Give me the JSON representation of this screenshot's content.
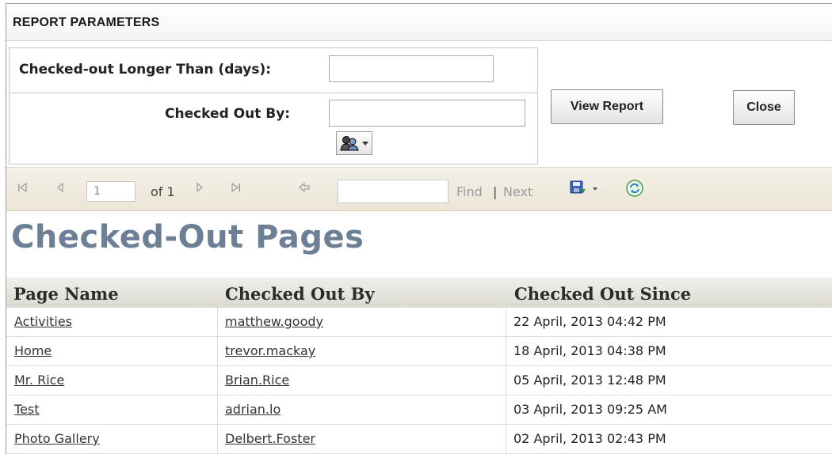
{
  "params": {
    "header": "REPORT PARAMETERS",
    "checked_out_longer_label": "Checked-out Longer Than (days):",
    "checked_out_longer_value": "",
    "checked_out_by_label": "Checked Out By:",
    "checked_out_by_value": "",
    "people_picker_icon": "people-picker-icon",
    "view_report_label": "View Report",
    "close_label": "Close"
  },
  "toolbar": {
    "page_value": "1",
    "of_text": "of 1",
    "find_value": "",
    "find_label": "Find",
    "separator": "|",
    "next_label": "Next",
    "icons": [
      "first-page-icon",
      "previous-page-icon",
      "next-page-icon",
      "last-page-icon",
      "back-icon",
      "export-icon",
      "refresh-icon"
    ]
  },
  "report": {
    "title": "Checked-Out Pages",
    "columns": [
      "Page Name",
      "Checked Out By",
      "Checked Out Since"
    ],
    "rows": [
      {
        "page": "Activities",
        "user": "matthew.goody",
        "since": "22 April, 2013 04:42 PM"
      },
      {
        "page": "Home",
        "user": "trevor.mackay",
        "since": "18 April, 2013 04:38 PM"
      },
      {
        "page": "Mr. Rice",
        "user": "Brian.Rice",
        "since": "05 April, 2013 12:48 PM"
      },
      {
        "page": "Test",
        "user": "adrian.lo",
        "since": "03 April, 2013 09:25 AM"
      },
      {
        "page": "Photo Gallery",
        "user": "Delbert.Foster",
        "since": "02 April, 2013 02:43 PM"
      }
    ]
  },
  "colors": {
    "title": "#6d7f95",
    "toolbar_bg": "#ece6d6",
    "header_row_bg": "#dcdad2"
  }
}
